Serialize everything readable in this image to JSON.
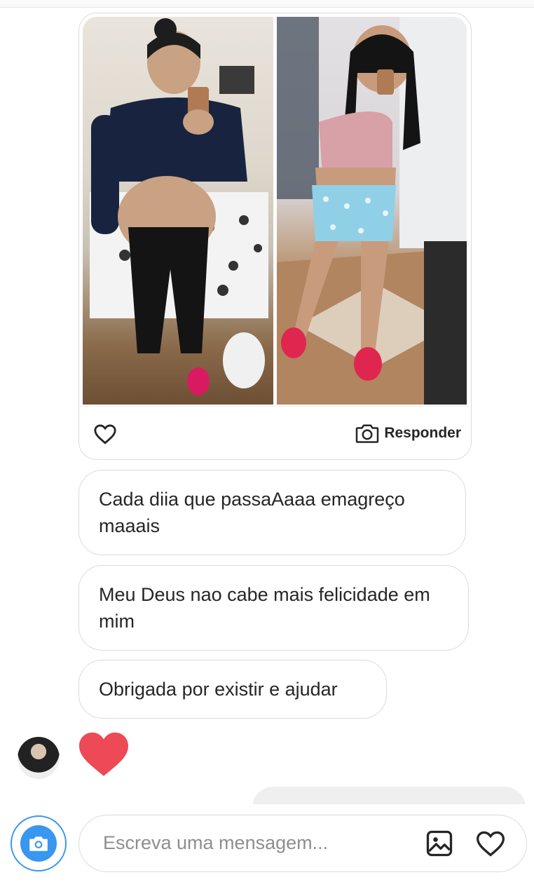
{
  "card": {
    "reply_label": "Responder"
  },
  "messages": [
    "Cada diia que passaAaaa emagreço maaais",
    "Meu Deus  nao cabe mais felicidade em mim",
    "Obrigada por existir e ajudar"
  ],
  "composer": {
    "placeholder": "Escreva uma mensagem..."
  },
  "colors": {
    "accent": "#3897f0",
    "heart_reaction": "#ed4956",
    "border": "#dbdbdb"
  },
  "icons": [
    "heart-icon",
    "camera-icon",
    "gallery-icon",
    "heart-reaction-icon"
  ]
}
